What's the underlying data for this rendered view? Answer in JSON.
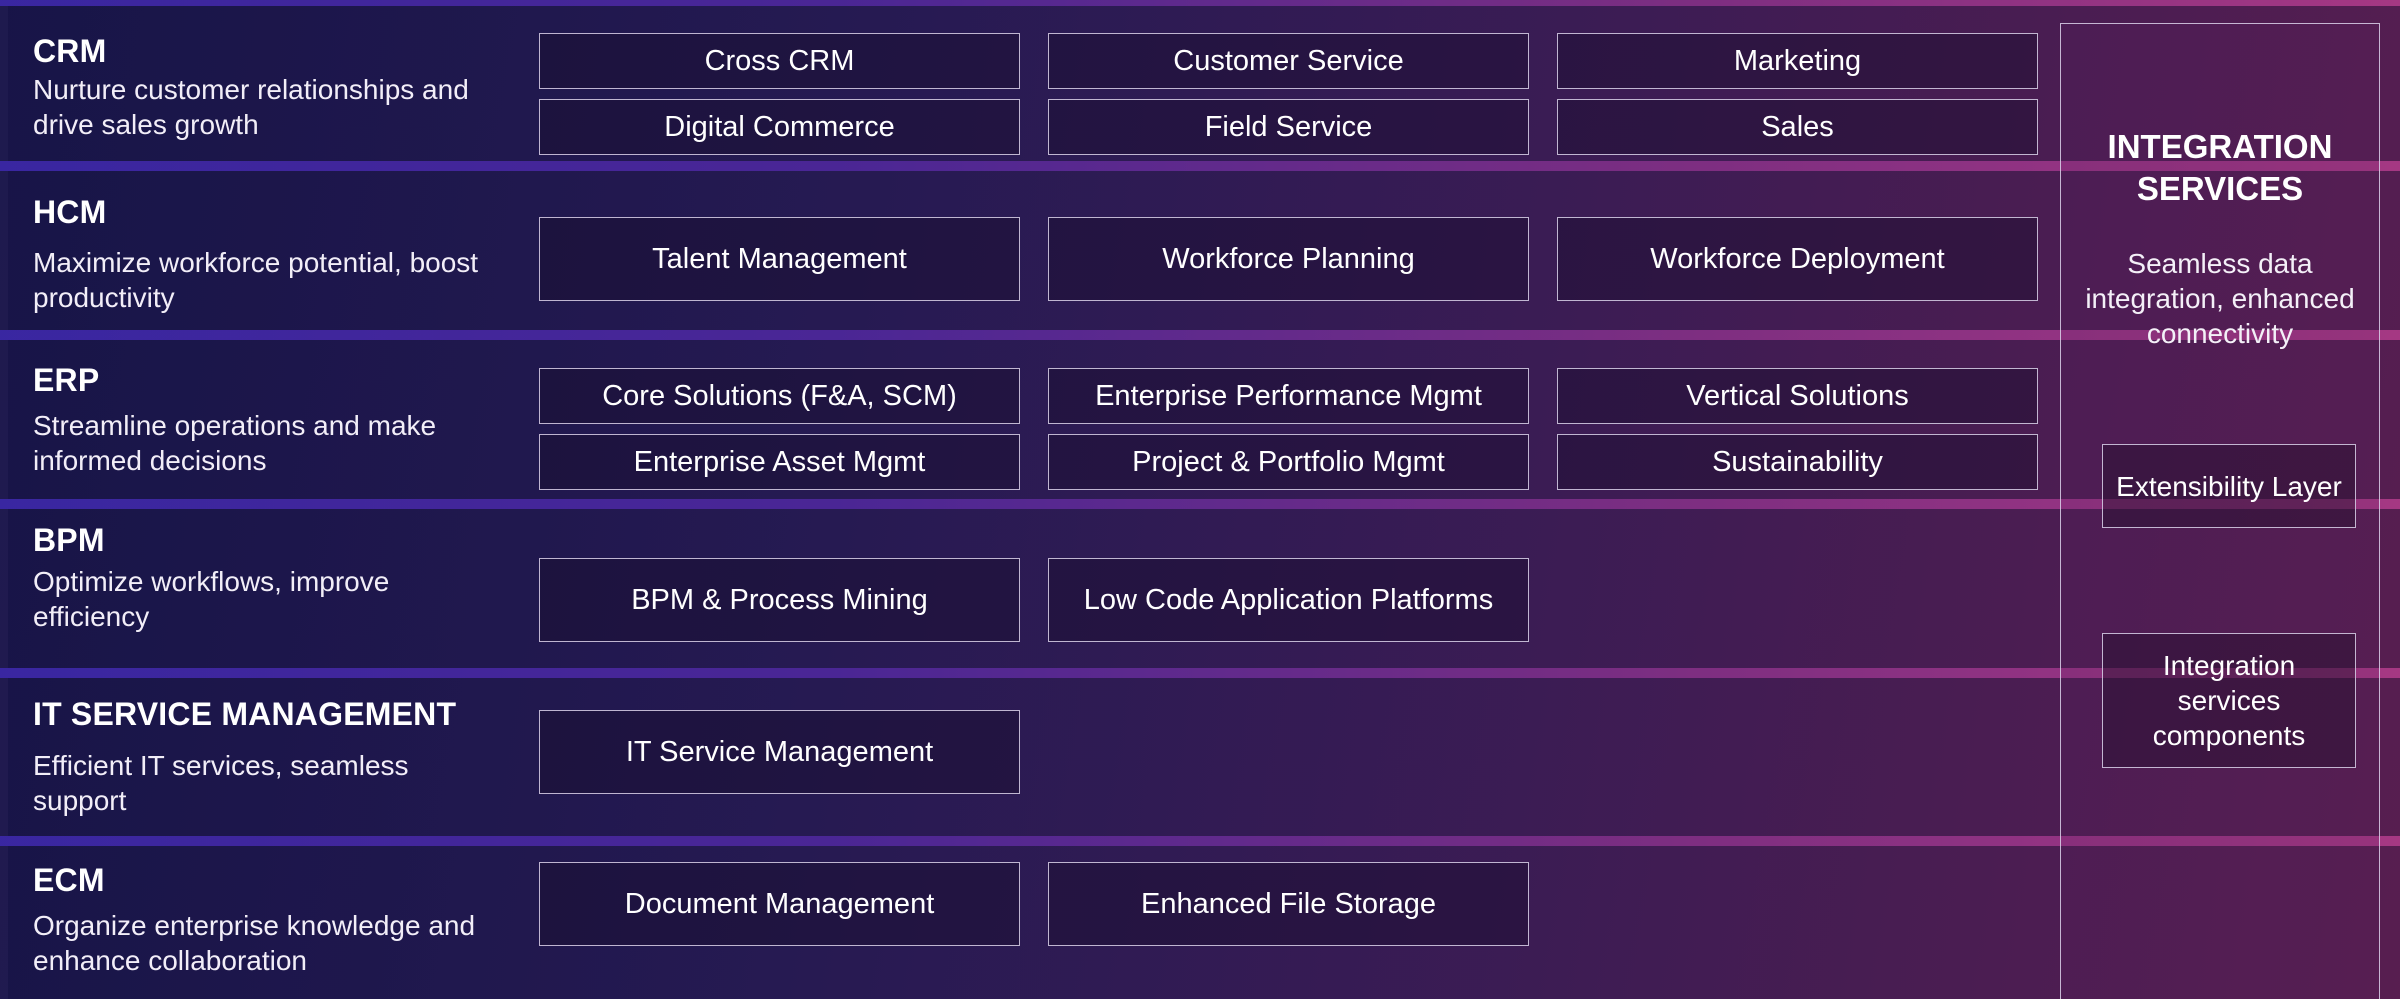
{
  "sections": [
    {
      "title": "CRM",
      "description": "Nurture customer relationships and drive sales growth",
      "items": [
        "Cross CRM",
        "Customer Service",
        "Marketing",
        "Digital Commerce",
        "Field Service",
        "Sales"
      ]
    },
    {
      "title": "HCM",
      "description": "Maximize workforce potential, boost productivity",
      "items": [
        "Talent Management",
        "Workforce Planning",
        "Workforce Deployment"
      ]
    },
    {
      "title": "ERP",
      "description": "Streamline operations and make informed decisions",
      "items": [
        "Core Solutions (F&A, SCM)",
        "Enterprise Performance Mgmt",
        "Vertical Solutions",
        "Enterprise Asset Mgmt",
        "Project & Portfolio Mgmt",
        "Sustainability"
      ]
    },
    {
      "title": "BPM",
      "description": "Optimize workflows, improve efficiency",
      "items": [
        "BPM & Process Mining",
        "Low Code Application Platforms"
      ]
    },
    {
      "title": "IT SERVICE MANAGEMENT",
      "description": "Efficient IT services, seamless support",
      "items": [
        "IT Service Management"
      ]
    },
    {
      "title": "ECM",
      "description": "Organize enterprise knowledge and enhance collaboration",
      "items": [
        "Document Management",
        "Enhanced File Storage"
      ]
    }
  ],
  "integration": {
    "title": "INTEGRATION\nSERVICES",
    "description": "Seamless data\nintegration, enhanced\nconnectivity",
    "boxes": [
      "Extensibility Layer",
      "Integration\nservices\ncomponents"
    ]
  },
  "colors": {
    "background_start": "#1e1a4e",
    "background_end": "#551f50",
    "separator_start": "#3c28aa",
    "separator_end": "#b43c8c",
    "box_border": "#dcd2eb",
    "text": "#ffffff"
  }
}
